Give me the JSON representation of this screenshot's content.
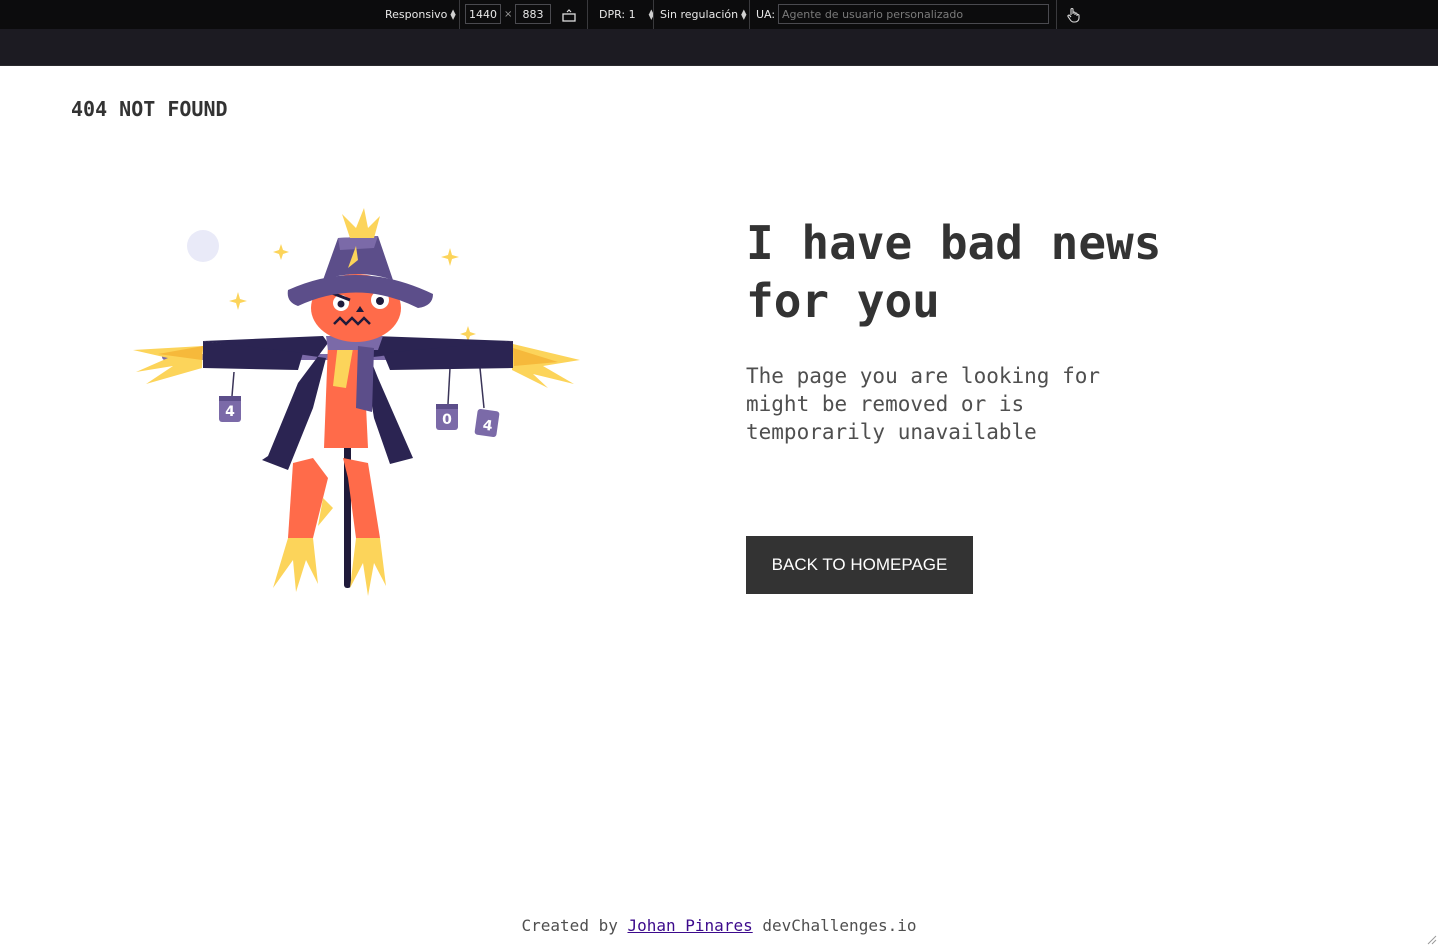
{
  "devtools": {
    "device": "Responsivo",
    "width": "1440",
    "times": "×",
    "height": "883",
    "dpr": "DPR: 1",
    "throttling": "Sin regulación",
    "ua_label": "UA:",
    "ua_placeholder": "Agente de usuario personalizado",
    "icons": [
      "select-arrows-icon",
      "rotate-icon",
      "touch-icon"
    ]
  },
  "page": {
    "brand": "404 NOT FOUND",
    "headline": "I have bad news for you",
    "message": "The page you are looking for might be removed or is temporarily unavailable",
    "button_label": "BACK TO HOMEPAGE",
    "footer": {
      "prefix": "Created by",
      "author": "Johan Pinares",
      "suffix": "devChallenges.io"
    },
    "illustration": {
      "subject": "scarecrow",
      "can_labels": [
        "4",
        "0",
        "4"
      ]
    },
    "colors": {
      "text_dark": "#333333",
      "button_bg": "#333333",
      "link": "#3c0a8c"
    }
  }
}
